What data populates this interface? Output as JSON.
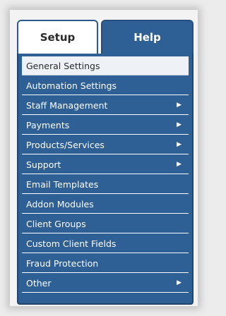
{
  "tabs": [
    {
      "label": "Setup",
      "active": true
    },
    {
      "label": "Help",
      "active": false
    }
  ],
  "menu": {
    "items": [
      {
        "label": "General Settings",
        "has_submenu": false,
        "active": true
      },
      {
        "label": "Automation Settings",
        "has_submenu": false
      },
      {
        "label": "Staff Management",
        "has_submenu": true
      },
      {
        "label": "Payments",
        "has_submenu": true
      },
      {
        "label": "Products/Services",
        "has_submenu": true
      },
      {
        "label": "Support",
        "has_submenu": true
      },
      {
        "label": "Email Templates",
        "has_submenu": false
      },
      {
        "label": "Addon Modules",
        "has_submenu": false
      },
      {
        "label": "Client Groups",
        "has_submenu": false
      },
      {
        "label": "Custom Client Fields",
        "has_submenu": false
      },
      {
        "label": "Fraud Protection",
        "has_submenu": false
      },
      {
        "label": "Other",
        "has_submenu": true
      }
    ],
    "submenu_arrow": "▶"
  },
  "colors": {
    "menu_bg": "#2e5f95",
    "active_item_bg": "#eef2f7",
    "text_light": "#ffffff"
  }
}
